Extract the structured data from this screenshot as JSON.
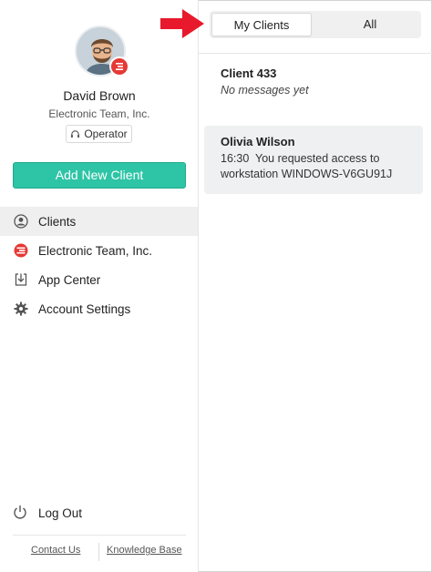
{
  "user": {
    "name": "David Brown",
    "company": "Electronic Team, Inc.",
    "role": "Operator"
  },
  "sidebar": {
    "add_button_label": "Add New Client",
    "items": [
      {
        "label": "Clients",
        "icon": "user-circle-icon"
      },
      {
        "label": "Electronic Team, Inc.",
        "icon": "company-logo-icon"
      },
      {
        "label": "App Center",
        "icon": "download-icon"
      },
      {
        "label": "Account Settings",
        "icon": "gear-icon"
      }
    ],
    "logout_label": "Log Out",
    "footer": {
      "contact": "Contact Us",
      "knowledge": "Knowledge Base"
    }
  },
  "tabs": [
    {
      "label": "My Clients",
      "active": true
    },
    {
      "label": "All",
      "active": false
    }
  ],
  "clients": [
    {
      "name": "Client 433",
      "message": "No messages yet"
    },
    {
      "name": "Olivia Wilson",
      "time": "16:30",
      "message": "You requested access to workstation WINDOWS-V6GU91J"
    }
  ],
  "colors": {
    "accent": "#2ec4a6",
    "badge": "#e53935",
    "annotation_arrow": "#e8192c",
    "selected_row": "#eef0f2"
  }
}
